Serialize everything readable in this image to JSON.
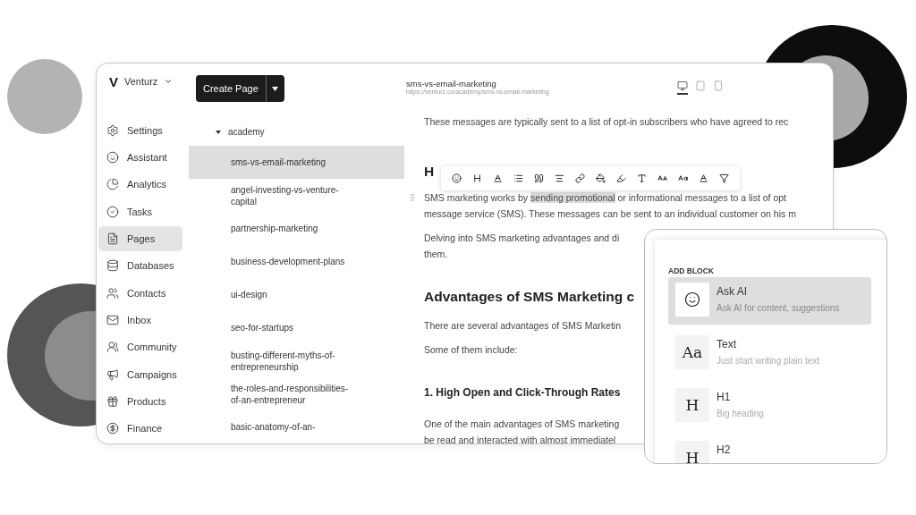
{
  "workspace": {
    "logo": "V",
    "name": "Venturz"
  },
  "sidebar": {
    "items": [
      {
        "label": "Settings",
        "selected": false
      },
      {
        "label": "Assistant",
        "selected": false
      },
      {
        "label": "Analytics",
        "selected": false
      },
      {
        "label": "Tasks",
        "selected": false
      },
      {
        "label": "Pages",
        "selected": true
      },
      {
        "label": "Databases",
        "selected": false
      },
      {
        "label": "Contacts",
        "selected": false
      },
      {
        "label": "Inbox",
        "selected": false
      },
      {
        "label": "Community",
        "selected": false
      },
      {
        "label": "Campaigns",
        "selected": false
      },
      {
        "label": "Products",
        "selected": false
      },
      {
        "label": "Finance",
        "selected": false
      }
    ]
  },
  "create_button": {
    "label": "Create Page"
  },
  "page_tree": [
    {
      "label": "academy",
      "expanded": true,
      "children": [
        {
          "label": "sms-vs-email-marketing",
          "selected": true
        },
        {
          "label": "angel-investing-vs-venture-capital",
          "selected": false
        },
        {
          "label": "partnership-marketing",
          "selected": false
        },
        {
          "label": "business-development-plans",
          "selected": false
        },
        {
          "label": "ui-design",
          "selected": false
        },
        {
          "label": "seo-for-startups",
          "selected": false
        },
        {
          "label": "busting-different-myths-of-entrepreneurship",
          "selected": false
        },
        {
          "label": "the-roles-and-responsibilities-of-an-entrepreneur",
          "selected": false
        },
        {
          "label": "basic-anatomy-of-an-",
          "selected": false
        }
      ]
    }
  ],
  "editor": {
    "page_title": "sms-vs-email-marketing",
    "page_url": "https://venturz.co/academy/sms-vs-email-marketing",
    "device_views": [
      {
        "kind": "desktop",
        "selected": true
      },
      {
        "kind": "tablet",
        "selected": false
      },
      {
        "kind": "phone",
        "selected": false
      }
    ],
    "blocks": [
      {
        "kind": "paragraph",
        "text": "These messages are typically sent to a list of opt-in subscribers who have agreed to rec"
      },
      {
        "kind": "heading",
        "text": "H"
      },
      {
        "kind": "highlighted_paragraph",
        "before": "SMS marketing works by ",
        "highlight": "sending promotional",
        "after": " or informational messages to a list of opt",
        "second_line": "message service (SMS). These messages can be sent to an individual customer on his m"
      },
      {
        "kind": "paragraph",
        "text": "Delving into SMS marketing advantages and di",
        "second_line": "them."
      },
      {
        "kind": "heading",
        "text": "Advantages of SMS Marketing c"
      },
      {
        "kind": "paragraph",
        "text": "There are several advantages of SMS Marketin"
      },
      {
        "kind": "paragraph",
        "text": "Some of them include:"
      },
      {
        "kind": "subheading",
        "text": "1. High Open and Click-Through Rates"
      },
      {
        "kind": "paragraph",
        "text": "One of the main advantages of SMS marketing",
        "second_line": "be read and interacted with almost immediatel"
      }
    ]
  },
  "add_block": {
    "title": "ADD BLOCK",
    "items": [
      {
        "kind": "ai",
        "title": "Ask AI",
        "description": "Ask AI for content, suggestions",
        "selected": true
      },
      {
        "kind": "glyph",
        "glyph": "Aa",
        "title": "Text",
        "description": "Just start writing plain text",
        "selected": false
      },
      {
        "kind": "glyph",
        "glyph": "H",
        "title": "H1",
        "description": "Big heading",
        "selected": false
      },
      {
        "kind": "glyph",
        "glyph": "H",
        "title": "H2",
        "selected": false
      }
    ]
  }
}
